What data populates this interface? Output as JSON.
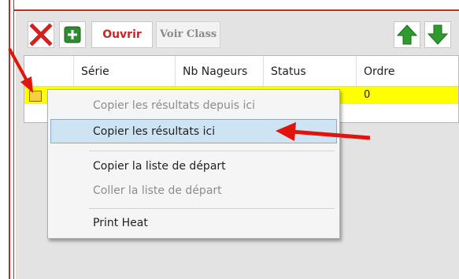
{
  "toolbar": {
    "delete_icon": "red-x-icon",
    "add_icon": "green-plus-icon",
    "ouvrir_label": "Ouvrir",
    "voir_label": "Voir Class",
    "up_icon": "green-up-arrow-icon",
    "down_icon": "green-down-arrow-icon"
  },
  "grid": {
    "columns": [
      "",
      "Série",
      "Nb Nageurs",
      "Status",
      "Ordre"
    ],
    "rows": [
      {
        "serie": "",
        "nb_nageurs": "",
        "status": "",
        "ordre": "0"
      }
    ]
  },
  "context_menu": {
    "items": [
      {
        "label": "Copier les résultats depuis ici",
        "enabled": false
      },
      {
        "label": "Copier les résultats ici",
        "enabled": true,
        "highlighted": true
      },
      {
        "label": "Copier la liste de départ",
        "enabled": true
      },
      {
        "label": "Coller la liste de départ",
        "enabled": false
      },
      {
        "label": "Print Heat",
        "enabled": true
      }
    ]
  },
  "colors": {
    "accent_red": "#c62828",
    "selection_yellow": "#ffff00",
    "menu_highlight": "#cfe4f3",
    "annotation_arrow": "#e0140a"
  }
}
